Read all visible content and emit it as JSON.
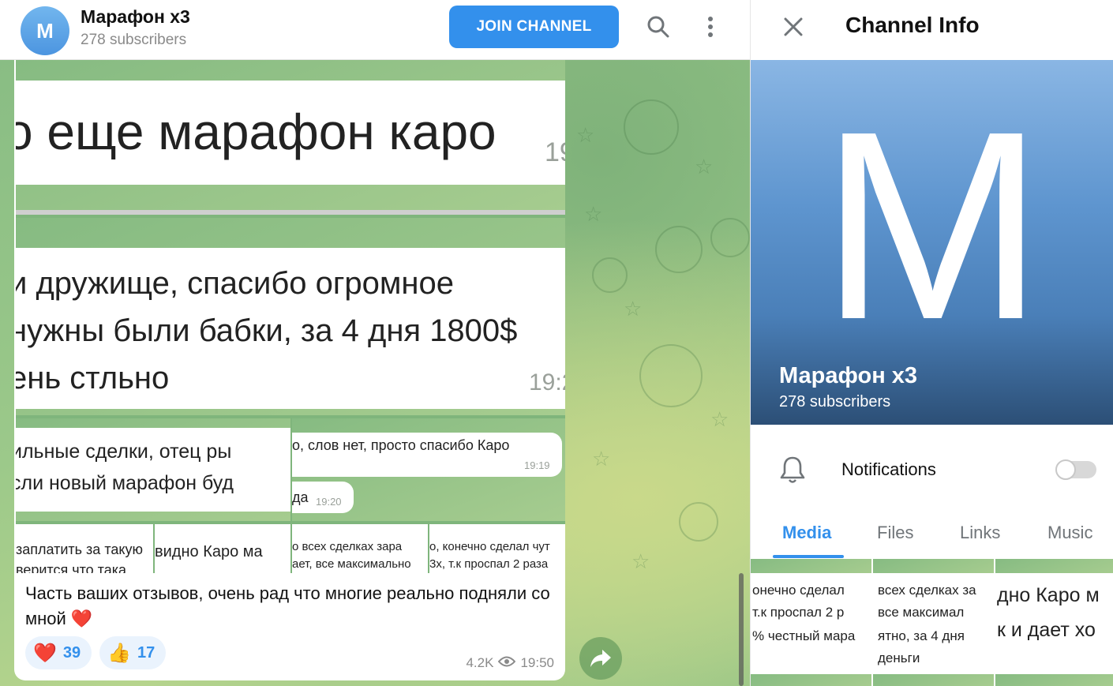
{
  "chat": {
    "title": "Марафон х3",
    "subtitle": "278 subscribers",
    "avatar_letter": "M",
    "join_label": "JOIN CHANNEL"
  },
  "collage": {
    "shot1_text": "о еще марафон каро",
    "shot1_time": "19",
    "shot2_lines": [
      "и дружище, спасибо огромное",
      "нужны были бабки, за 4 дня 1800$",
      "ень стльно"
    ],
    "shot2_time": "19:2",
    "shot3_lines": [
      "ильные сделки, отец ры",
      "сли новый марафон буд"
    ],
    "shot4_text": "о, слов нет, просто спасибо Каро",
    "shot4_time": "19:19",
    "shot5_text": "да",
    "shot5_time": "19:20",
    "shot6_lines": [
      "заплатить за такую",
      "верится что така"
    ],
    "shot7_text": "видно Каро ма",
    "shot8_lines": [
      "о всех сделках зара",
      "ает, все максимально"
    ],
    "shot9_lines": [
      "о, конечно сделал чут",
      "3х, т.к проспал 2 раза"
    ]
  },
  "message": {
    "caption": "Часть ваших отзывов, очень рад что многие реально подняли со мной ❤️",
    "reactions": [
      {
        "emoji": "❤️",
        "count": "39"
      },
      {
        "emoji": "👍",
        "count": "17"
      }
    ],
    "views": "4.2K",
    "time": "19:50"
  },
  "info": {
    "title": "Channel Info",
    "cover_letter": "M",
    "name": "Марафон х3",
    "subscribers": "278 subscribers",
    "notifications_label": "Notifications",
    "notifications_enabled": false,
    "tabs": [
      "Media",
      "Files",
      "Links",
      "Music"
    ],
    "active_tab": "Media",
    "thumbs": [
      [
        "онечно сделал",
        "т.к проспал 2 р",
        "% честный мара"
      ],
      [
        "всех сделках за",
        "все максимал",
        "ятно, за 4 дня",
        "деньги"
      ],
      [
        "дно Каро м",
        "к и дает хо"
      ]
    ]
  },
  "colors": {
    "accent": "#3390ec",
    "reaction_bg": "#eaf3fd"
  }
}
